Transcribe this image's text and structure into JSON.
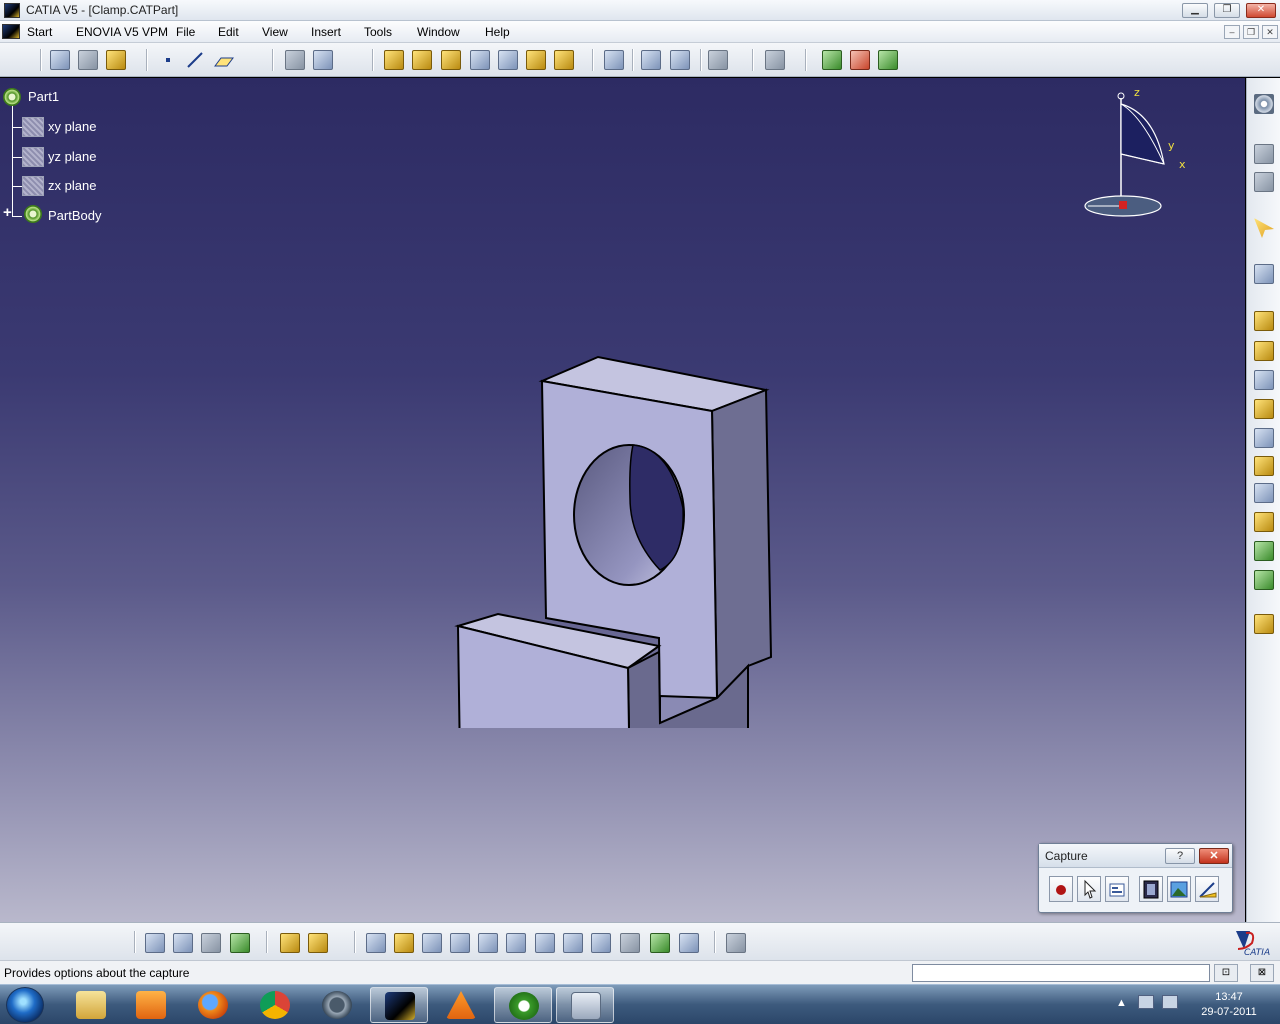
{
  "window": {
    "title": "CATIA V5 - [Clamp.CATPart]",
    "minimize": "▁",
    "restore": "❐",
    "close": "✕"
  },
  "menu": {
    "items": [
      "Start",
      "ENOVIA V5 VPM",
      "File",
      "Edit",
      "View",
      "Insert",
      "Tools",
      "Window",
      "Help"
    ]
  },
  "tree": {
    "root": "Part1",
    "planes": [
      "xy plane",
      "yz plane",
      "zx plane"
    ],
    "body": "PartBody"
  },
  "compass": {
    "axis_z": "z",
    "axis_y": "y",
    "axis_x": "x"
  },
  "capture": {
    "title": "Capture",
    "help": "?",
    "close": "✕"
  },
  "status": {
    "message": "Provides options about the capture",
    "command_value": ""
  },
  "taskbar": {
    "time": "13:47",
    "date": "29-07-2011"
  },
  "brand": {
    "logo_text": "CATIA"
  },
  "colors": {
    "part_face_front": "#b0b0d8",
    "part_face_side": "#6e6e92",
    "part_face_top": "#c4c4e0",
    "viewport_top": "#2d2b63",
    "viewport_bottom": "#b9b8cc"
  }
}
